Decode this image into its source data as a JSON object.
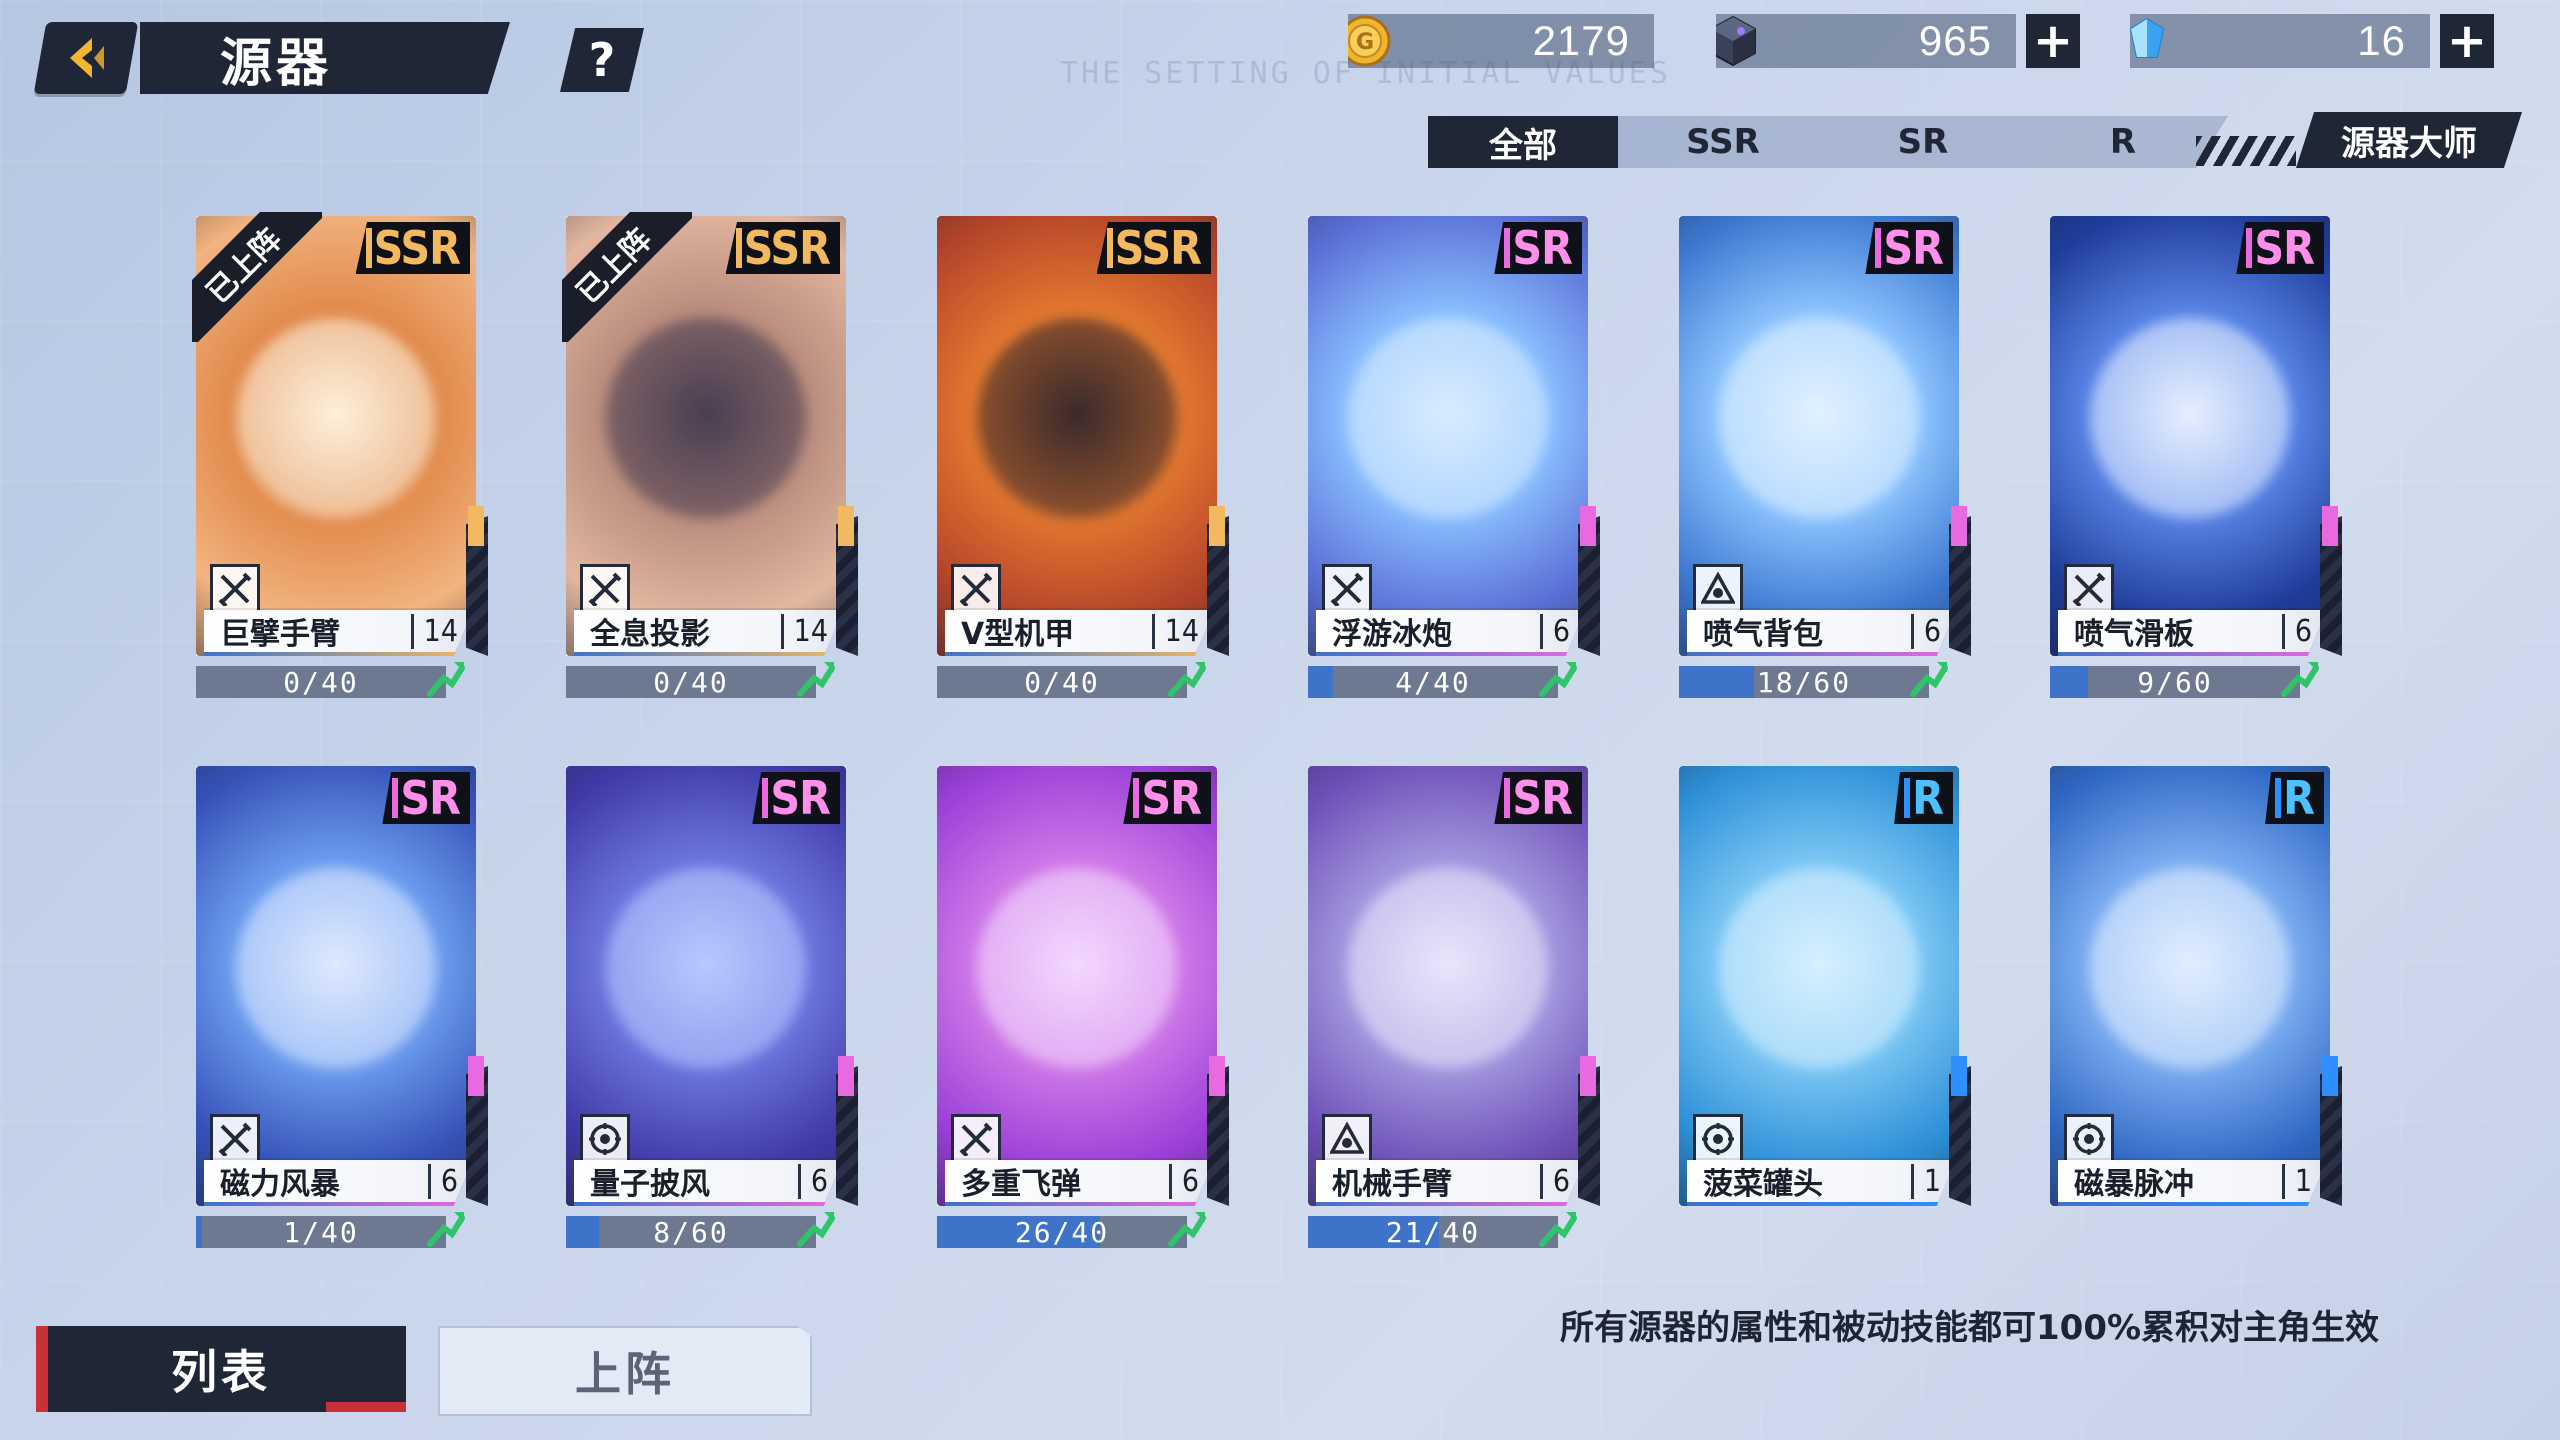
{
  "header": {
    "title": "源器",
    "help_label": "?"
  },
  "currencies": [
    {
      "name": "gold-coin",
      "value": "2179"
    },
    {
      "name": "cube",
      "value": "965"
    },
    {
      "name": "crystal",
      "value": "16"
    }
  ],
  "plus_label": "+",
  "background_watermark": "THE SETTING OF INITIAL VALUES",
  "tabs": [
    {
      "label": "全部",
      "active": true
    },
    {
      "label": "SSR",
      "active": false
    },
    {
      "label": "SR",
      "active": false
    },
    {
      "label": "R",
      "active": false
    }
  ],
  "master_button": "源器大师",
  "deployed_label": "已上阵",
  "cards": [
    {
      "name": "巨擘手臂",
      "level": "14",
      "rarity": "SSR",
      "progress": "0/40",
      "fill": 0.0,
      "deployed": true,
      "type_icon": "crossed-swords-icon",
      "theme": [
        "#f2b480",
        "#e08848",
        "#fdf0dc"
      ]
    },
    {
      "name": "全息投影",
      "level": "14",
      "rarity": "SSR",
      "progress": "0/40",
      "fill": 0.0,
      "deployed": true,
      "type_icon": "crossed-swords-icon",
      "theme": [
        "#e3b7a0",
        "#b88a7c",
        "#4a3f52"
      ]
    },
    {
      "name": "V型机甲",
      "level": "14",
      "rarity": "SSR",
      "progress": "0/40",
      "fill": 0.0,
      "deployed": false,
      "type_icon": "crossed-swords-icon",
      "theme": [
        "#b4442a",
        "#e57a2f",
        "#3b2a2c"
      ]
    },
    {
      "name": "浮游冰炮",
      "level": "6",
      "rarity": "SR",
      "progress": "4/40",
      "fill": 0.1,
      "deployed": false,
      "type_icon": "crossed-swords-icon",
      "theme": [
        "#5a6fd6",
        "#8bc0ff",
        "#d9ecff"
      ]
    },
    {
      "name": "喷气背包",
      "level": "6",
      "rarity": "SR",
      "progress": "18/60",
      "fill": 0.3,
      "deployed": false,
      "type_icon": "eye-triangle-icon",
      "theme": [
        "#3c78d0",
        "#8fc6ff",
        "#e2f1ff"
      ]
    },
    {
      "name": "喷气滑板",
      "level": "6",
      "rarity": "SR",
      "progress": "9/60",
      "fill": 0.15,
      "deployed": false,
      "type_icon": "crossed-swords-icon",
      "theme": [
        "#1e3c9a",
        "#5a86e8",
        "#e6efff"
      ]
    },
    {
      "name": "磁力风暴",
      "level": "6",
      "rarity": "SR",
      "progress": "1/40",
      "fill": 0.025,
      "deployed": false,
      "type_icon": "crossed-swords-icon",
      "theme": [
        "#3552b8",
        "#6fa0f0",
        "#dfe9ff"
      ]
    },
    {
      "name": "量子披风",
      "level": "6",
      "rarity": "SR",
      "progress": "8/60",
      "fill": 0.133,
      "deployed": false,
      "type_icon": "target-gear-icon",
      "theme": [
        "#3f3aa8",
        "#6f78e0",
        "#b9c8ff"
      ]
    },
    {
      "name": "多重飞弹",
      "level": "6",
      "rarity": "SR",
      "progress": "26/40",
      "fill": 0.65,
      "deployed": false,
      "type_icon": "crossed-swords-icon",
      "theme": [
        "#9a3fd8",
        "#d07be8",
        "#f3d9ff"
      ]
    },
    {
      "name": "机械手臂",
      "level": "6",
      "rarity": "SR",
      "progress": "21/40",
      "fill": 0.525,
      "deployed": false,
      "type_icon": "eye-triangle-icon",
      "theme": [
        "#6d4fb6",
        "#a59ae0",
        "#e9e6fb"
      ]
    },
    {
      "name": "菠菜罐头",
      "level": "1",
      "rarity": "R",
      "progress": "",
      "fill": null,
      "deployed": false,
      "type_icon": "target-gear-icon",
      "theme": [
        "#2d8fd6",
        "#7ec8f5",
        "#d6f0ff"
      ]
    },
    {
      "name": "磁暴脉冲",
      "level": "1",
      "rarity": "R",
      "progress": "",
      "fill": null,
      "deployed": false,
      "type_icon": "target-gear-icon",
      "theme": [
        "#2f67c4",
        "#7fb0f2",
        "#e2eeff"
      ]
    }
  ],
  "bottom": {
    "list_button": "列表",
    "deploy_button": "上阵",
    "note": "所有源器的属性和被动技能都可100%累积对主角生效"
  },
  "colors": {
    "dark_panel": "#1f2636",
    "ssr": "#f2b960",
    "sr": "#e869e0",
    "r": "#2f8fff",
    "progress_fill": "#3f73c9",
    "accent_red": "#c8303c"
  }
}
